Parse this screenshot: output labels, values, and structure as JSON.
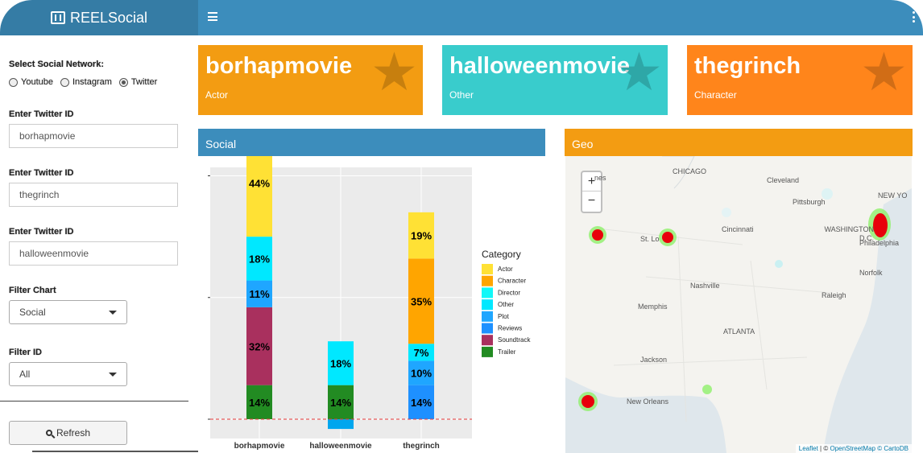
{
  "header": {
    "app_title": "REELSocial"
  },
  "sidebar": {
    "network_label": "Select Social Network:",
    "network_options": [
      "Youtube",
      "Instagram",
      "Twitter"
    ],
    "network_selected": "Twitter",
    "twitter_id_label_1": "Enter Twitter ID",
    "twitter_id_value_1": "borhapmovie",
    "twitter_id_label_2": "Enter Twitter ID",
    "twitter_id_value_2": "thegrinch",
    "twitter_id_label_3": "Enter Twitter ID",
    "twitter_id_value_3": "halloweenmovie",
    "filter_chart_label": "Filter Chart",
    "filter_chart_value": "Social",
    "filter_id_label": "Filter ID",
    "filter_id_value": "All",
    "refresh_label": "Refresh"
  },
  "value_boxes": [
    {
      "title": "borhapmovie",
      "subtitle": "Actor",
      "color": "#f39c12"
    },
    {
      "title": "halloweenmovie",
      "subtitle": "Other",
      "color": "#39cccc"
    },
    {
      "title": "thegrinch",
      "subtitle": "Character",
      "color": "#ff851b"
    }
  ],
  "social_panel": {
    "title": "Social",
    "color": "#3c8dbc"
  },
  "geo_panel": {
    "title": "Geo",
    "color": "#f39c12",
    "zoom_in": "+",
    "zoom_out": "−",
    "cities": [
      "CHICAGO",
      "Cleveland",
      "NEW YO",
      "Pittsburgh",
      "St. Lo",
      "Cincinnati",
      "WASHINGTON D.C.",
      "Philadelphia",
      "Norfolk",
      "Nashville",
      "Raleigh",
      "Memphis",
      "ATLANTA",
      "Jackson",
      "New Orleans",
      "nes"
    ],
    "attribution_leaflet": "Leaflet",
    "attribution_separator": "| ©",
    "attribution_osm": "OpenStreetMap",
    "attribution_carto": "© CartoDB"
  },
  "chart_data": {
    "type": "bar",
    "stacked": true,
    "categories": [
      "borhapmovie",
      "halloweenmovie",
      "thegrinch"
    ],
    "legend_title": "Category",
    "legend_position": "right",
    "grid": true,
    "reference_line": {
      "y": 0,
      "style": "dashed",
      "color": "#e8393a"
    },
    "series": [
      {
        "name": "Trailer",
        "color": "#228b22",
        "values": [
          14,
          14,
          0
        ],
        "labels": [
          "14%",
          "14%",
          ""
        ]
      },
      {
        "name": "Soundtrack",
        "color": "#a9305e",
        "values": [
          32,
          0,
          0
        ],
        "labels": [
          "32%",
          "",
          ""
        ]
      },
      {
        "name": "Reviews",
        "color": "#1e90ff",
        "values": [
          0,
          0,
          14
        ],
        "labels": [
          "",
          "",
          "14%"
        ]
      },
      {
        "name": "Plot",
        "color": "#1fa6ff",
        "values": [
          11,
          0,
          10
        ],
        "labels": [
          "11%",
          "",
          "10%"
        ]
      },
      {
        "name": "Other",
        "color": "#00e8ff",
        "values": [
          18,
          18,
          7
        ],
        "labels": [
          "18%",
          "18%",
          "7%"
        ]
      },
      {
        "name": "Director",
        "color": "#10f8f8",
        "values": [
          0,
          0,
          0
        ],
        "labels": [
          "",
          "",
          ""
        ]
      },
      {
        "name": "Character",
        "color": "#ffa500",
        "values": [
          0,
          0,
          35
        ],
        "labels": [
          "",
          "",
          "35%"
        ]
      },
      {
        "name": "Actor",
        "color": "#ffe135",
        "values": [
          44,
          0,
          19
        ],
        "labels": [
          "44%",
          "",
          "19%"
        ]
      }
    ],
    "legend_order": [
      "Actor",
      "Character",
      "Director",
      "Other",
      "Plot",
      "Reviews",
      "Soundtrack",
      "Trailer"
    ],
    "below_zero": [
      0,
      4,
      0
    ]
  }
}
